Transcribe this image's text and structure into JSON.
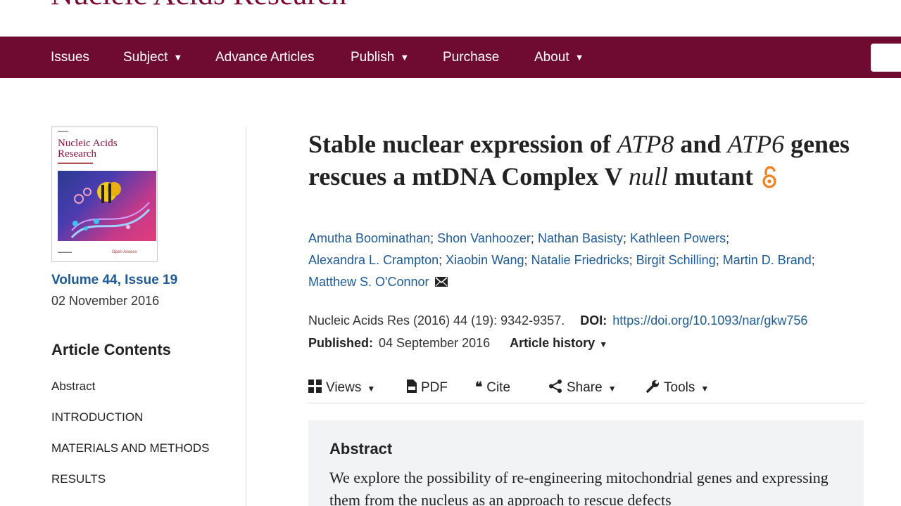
{
  "site": {
    "name": "Nucleic Acids Research"
  },
  "nav": {
    "items": [
      {
        "label": "Issues",
        "dropdown": false
      },
      {
        "label": "Subject",
        "dropdown": true
      },
      {
        "label": "Advance Articles",
        "dropdown": false
      },
      {
        "label": "Publish",
        "dropdown": true
      },
      {
        "label": "Purchase",
        "dropdown": false
      },
      {
        "label": "About",
        "dropdown": true
      }
    ],
    "caret": "▼"
  },
  "cover": {
    "journal_title": "Nucleic Acids Research",
    "open_access_label": "Open Access"
  },
  "issue": {
    "volume_link": "Volume 44, Issue 19",
    "date": "02 November 2016"
  },
  "contents": {
    "heading": "Article Contents",
    "items": [
      "Abstract",
      "INTRODUCTION",
      "MATERIALS AND METHODS",
      "RESULTS"
    ]
  },
  "article": {
    "title_parts": {
      "p1": "Stable nuclear expression of ",
      "p2": "ATP8",
      "p3": " and ",
      "p4": "ATP6",
      "p5": " genes rescues a mtDNA Complex V ",
      "p6": "null",
      "p7": " mutant"
    },
    "authors": [
      "Amutha Boominathan",
      "Shon Vanhoozer",
      "Nathan Basisty",
      "Kathleen Powers",
      "Alexandra L. Crampton",
      "Xiaobin Wang",
      "Natalie Friedricks",
      "Birgit Schilling",
      "Martin D. Brand",
      "Matthew S. O'Connor"
    ],
    "author_separator": ";",
    "citation": "Nucleic Acids Res (2016) 44 (19): 9342-9357.",
    "doi_label": "DOI:",
    "doi_url": "https://doi.org/10.1093/nar/gkw756",
    "published_label": "Published:",
    "published_date": "04 September 2016",
    "history_label": "Article history",
    "history_caret": "▼"
  },
  "toolbar": {
    "views": "Views",
    "pdf": "PDF",
    "cite": "Cite",
    "share": "Share",
    "tools": "Tools",
    "caret": "▼"
  },
  "abstract": {
    "heading": "Abstract",
    "text": "We explore the possibility of re-engineering mitochondrial genes and expressing them from the nucleus as an approach to rescue defects"
  },
  "colors": {
    "brand": "#6f0b31",
    "link": "#1d5a94",
    "open_access": "#f07f1e",
    "abstract_bg": "#f2f3f5"
  }
}
